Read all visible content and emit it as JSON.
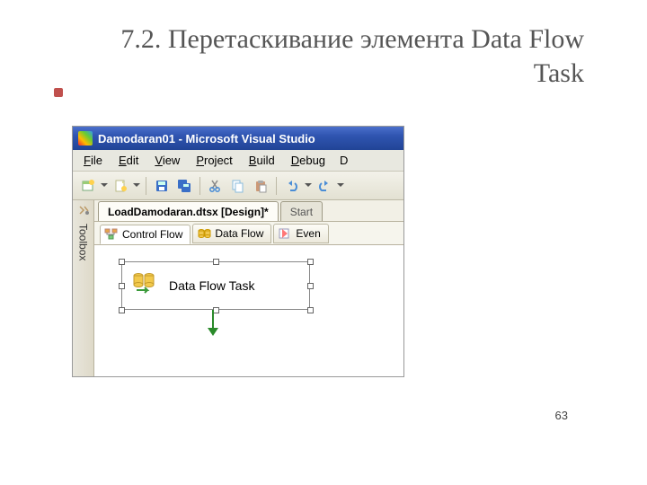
{
  "slide": {
    "title": "7.2. Перетаскивание  элемента Data Flow Task",
    "page_number": "63"
  },
  "titlebar": {
    "text": "Damodaran01 - Microsoft Visual Studio"
  },
  "menu": {
    "file": "File",
    "edit": "Edit",
    "view": "View",
    "project": "Project",
    "build": "Build",
    "debug": "Debug"
  },
  "toolbox": {
    "label": "Toolbox"
  },
  "doc_tabs": {
    "active": "LoadDamodaran.dtsx [Design]*",
    "second": "Start"
  },
  "designer_tabs": {
    "control_flow": "Control Flow",
    "data_flow": "Data Flow",
    "event": "Even"
  },
  "task": {
    "label": "Data Flow Task"
  }
}
